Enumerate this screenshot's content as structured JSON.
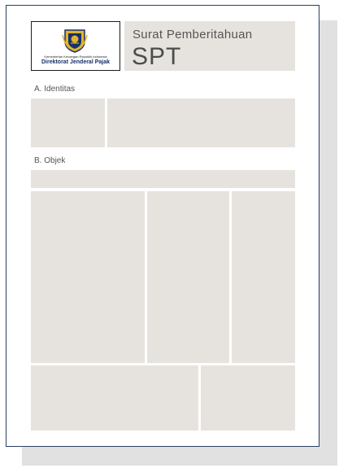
{
  "header": {
    "logo": {
      "ministry": "Kementerian Keuangan Republik Indonesia",
      "agency": "Direktorat Jenderal Pajak"
    },
    "subtitle": "Surat Pemberitahuan",
    "title": "SPT"
  },
  "sections": {
    "identitas": {
      "label": "A. Identitas"
    },
    "objek": {
      "label": "B. Objek"
    }
  },
  "colors": {
    "field_fill": "#e6e3de",
    "border": "#2c3d66",
    "logo_blue": "#15306a",
    "logo_gold": "#e1b32e"
  }
}
